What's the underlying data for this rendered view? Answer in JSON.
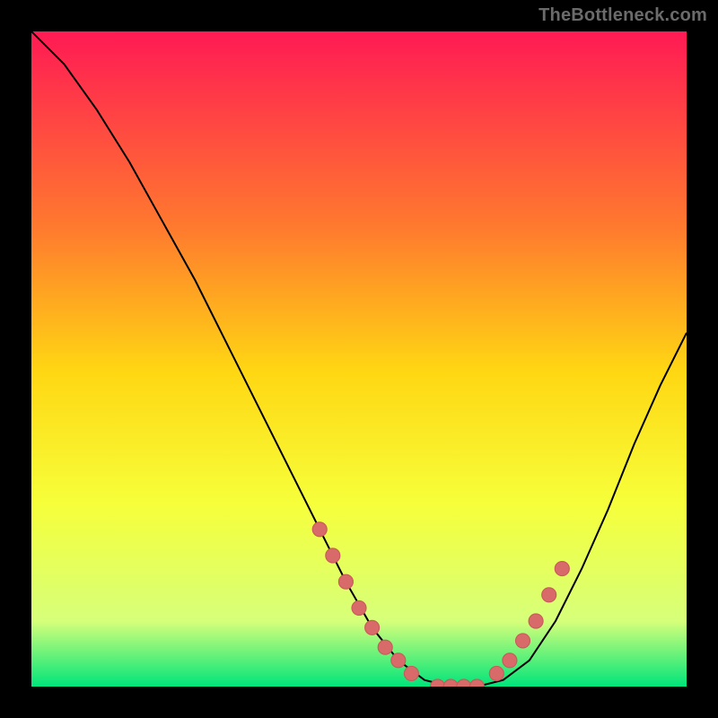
{
  "watermark": "TheBottleneck.com",
  "colors": {
    "page_bg": "#000000",
    "grad_top": "#ff1a54",
    "grad_mid_upper": "#ff7a2e",
    "grad_mid": "#ffd713",
    "grad_mid_lower": "#f6ff3a",
    "grad_lower": "#d6ff7a",
    "grad_bottom": "#00e57a",
    "curve": "#000000",
    "marker_fill": "#d86a6a",
    "marker_stroke": "#c95a5a"
  },
  "chart_data": {
    "type": "line",
    "title": "",
    "xlabel": "",
    "ylabel": "",
    "xlim": [
      0,
      100
    ],
    "ylim": [
      0,
      100
    ],
    "grid": false,
    "legend": false,
    "series": [
      {
        "name": "bottleneck-curve",
        "x": [
          0,
          5,
          10,
          15,
          20,
          25,
          30,
          35,
          40,
          45,
          48,
          52,
          56,
          60,
          64,
          68,
          72,
          76,
          80,
          84,
          88,
          92,
          96,
          100
        ],
        "y": [
          100,
          95,
          88,
          80,
          71,
          62,
          52,
          42,
          32,
          22,
          16,
          9,
          4,
          1,
          0,
          0,
          1,
          4,
          10,
          18,
          27,
          37,
          46,
          54
        ]
      }
    ],
    "markers": {
      "name": "highlighted-points",
      "x": [
        44,
        46,
        48,
        50,
        52,
        54,
        56,
        58,
        62,
        64,
        66,
        68,
        71,
        73,
        75,
        77,
        79,
        81
      ],
      "y": [
        24,
        20,
        16,
        12,
        9,
        6,
        4,
        2,
        0,
        0,
        0,
        0,
        2,
        4,
        7,
        10,
        14,
        18
      ]
    }
  }
}
